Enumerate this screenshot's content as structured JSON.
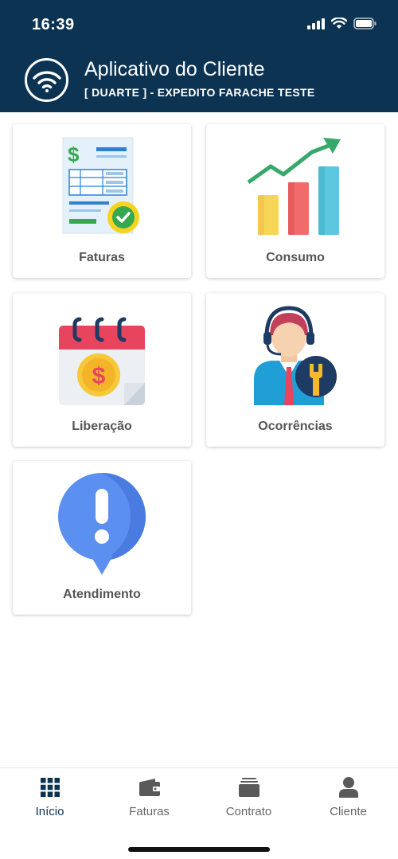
{
  "status_bar": {
    "time": "16:39",
    "icons": [
      "signal-icon",
      "wifi-icon",
      "battery-icon"
    ]
  },
  "header": {
    "title": "Aplicativo do Cliente",
    "subtitle": "[ DUARTE ] - EXPEDITO FARACHE TESTE",
    "logo_icon": "wifi-logo-icon",
    "background": "#0c3352"
  },
  "cards": [
    {
      "label": "Faturas",
      "icon": "invoice-icon"
    },
    {
      "label": "Consumo",
      "icon": "growth-chart-icon"
    },
    {
      "label": "Liberação",
      "icon": "calendar-payment-icon"
    },
    {
      "label": "Ocorrências",
      "icon": "support-agent-icon"
    },
    {
      "label": "Atendimento",
      "icon": "alert-bubble-icon"
    }
  ],
  "bottom_nav": {
    "items": [
      {
        "label": "Início",
        "icon": "grid-icon",
        "active": true
      },
      {
        "label": "Faturas",
        "icon": "wallet-icon",
        "active": false
      },
      {
        "label": "Contrato",
        "icon": "folder-icon",
        "active": false
      },
      {
        "label": "Cliente",
        "icon": "person-icon",
        "active": false
      }
    ],
    "active_color": "#0c3352",
    "inactive_color": "#666666"
  }
}
